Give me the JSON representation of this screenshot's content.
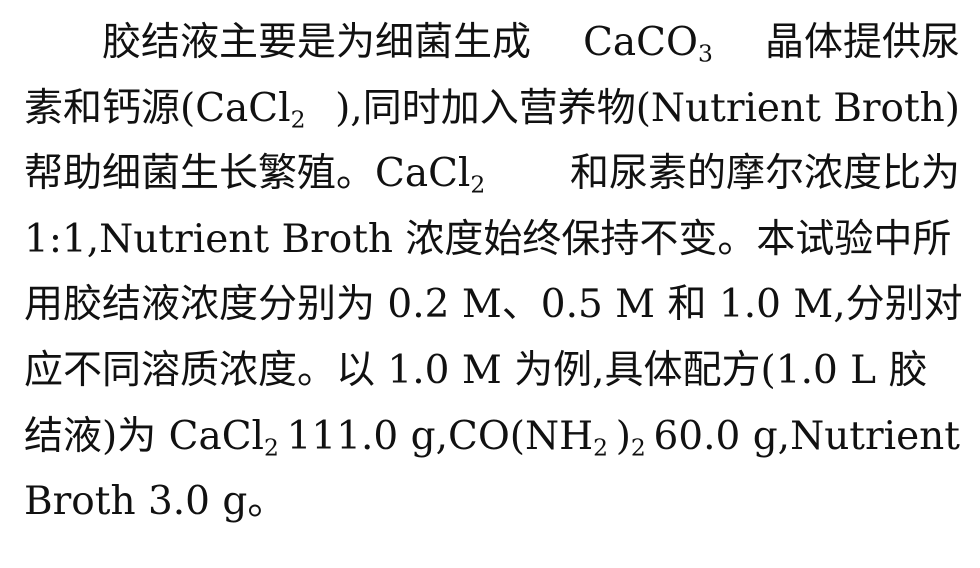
{
  "paragraph": {
    "lines": [
      {
        "segments": [
          {
            "text": "胶结液主要是为细菌生成"
          },
          {
            "text": "CaCO",
            "sub": "3"
          },
          {
            "text": "晶体提供尿"
          }
        ]
      },
      {
        "segments": [
          {
            "text": "素和钙源(CaCl",
            "sub": "2"
          },
          {
            "text": "),同时加入营养物(Nutrient Broth)"
          }
        ]
      },
      {
        "segments": [
          {
            "text": "帮助细菌生长繁殖。CaCl",
            "sub": "2"
          },
          {
            "text": "和尿素的摩尔浓度比为"
          }
        ]
      },
      {
        "segments": [
          {
            "text": "1:1,Nutrient Broth 浓度始终保持不变。本试验中所"
          }
        ]
      },
      {
        "segments": [
          {
            "text": "用胶结液浓度分别为 0.2 M、0.5 M 和 1.0 M,分别对"
          }
        ]
      },
      {
        "segments": [
          {
            "text": "应不同溶质浓度。以 1.0 M 为例,具体配方(1.0 L 胶"
          }
        ]
      },
      {
        "segments": [
          {
            "text": "结液)为 CaCl",
            "sub": "2"
          },
          {
            "text": " 111.0 g,CO(NH",
            "sub": "2"
          },
          {
            "text": ")",
            "sub": "2"
          },
          {
            "text": " 60.0 g,Nutrient"
          }
        ]
      },
      {
        "segments": [
          {
            "text": "Broth 3.0 g。"
          }
        ]
      }
    ]
  }
}
